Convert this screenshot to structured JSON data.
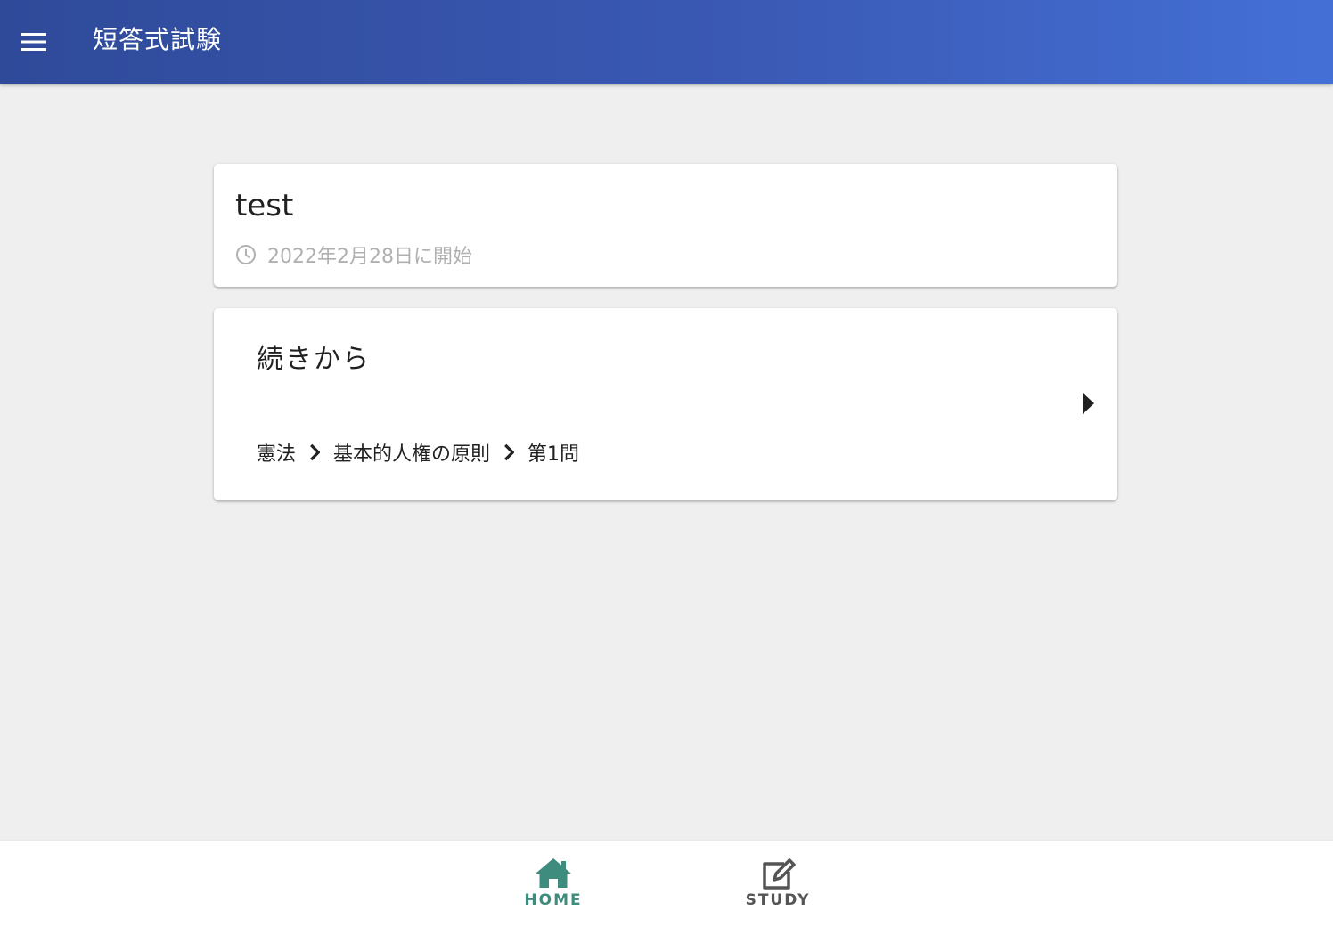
{
  "app_bar": {
    "title": "短答式試験",
    "menu_icon": "menu-icon"
  },
  "course_card": {
    "name": "test",
    "started_text": "2022年2月28日に開始",
    "clock_icon": "clock-icon"
  },
  "continue_card": {
    "title": "続きから",
    "breadcrumb": [
      "憲法",
      "基本的人権の原則",
      "第1問"
    ],
    "arrow_icon": "play-arrow-icon"
  },
  "bottom_nav": {
    "items": [
      {
        "label": "HOME",
        "icon": "home-icon",
        "active": true
      },
      {
        "label": "STUDY",
        "icon": "edit-icon",
        "active": false
      }
    ]
  },
  "colors": {
    "app_bar_start": "#2f4a99",
    "app_bar_end": "#4470d6",
    "background": "#efefef",
    "active_nav": "#3d8c7e",
    "inactive_nav": "#555555",
    "muted_text": "#b0b0b0"
  }
}
